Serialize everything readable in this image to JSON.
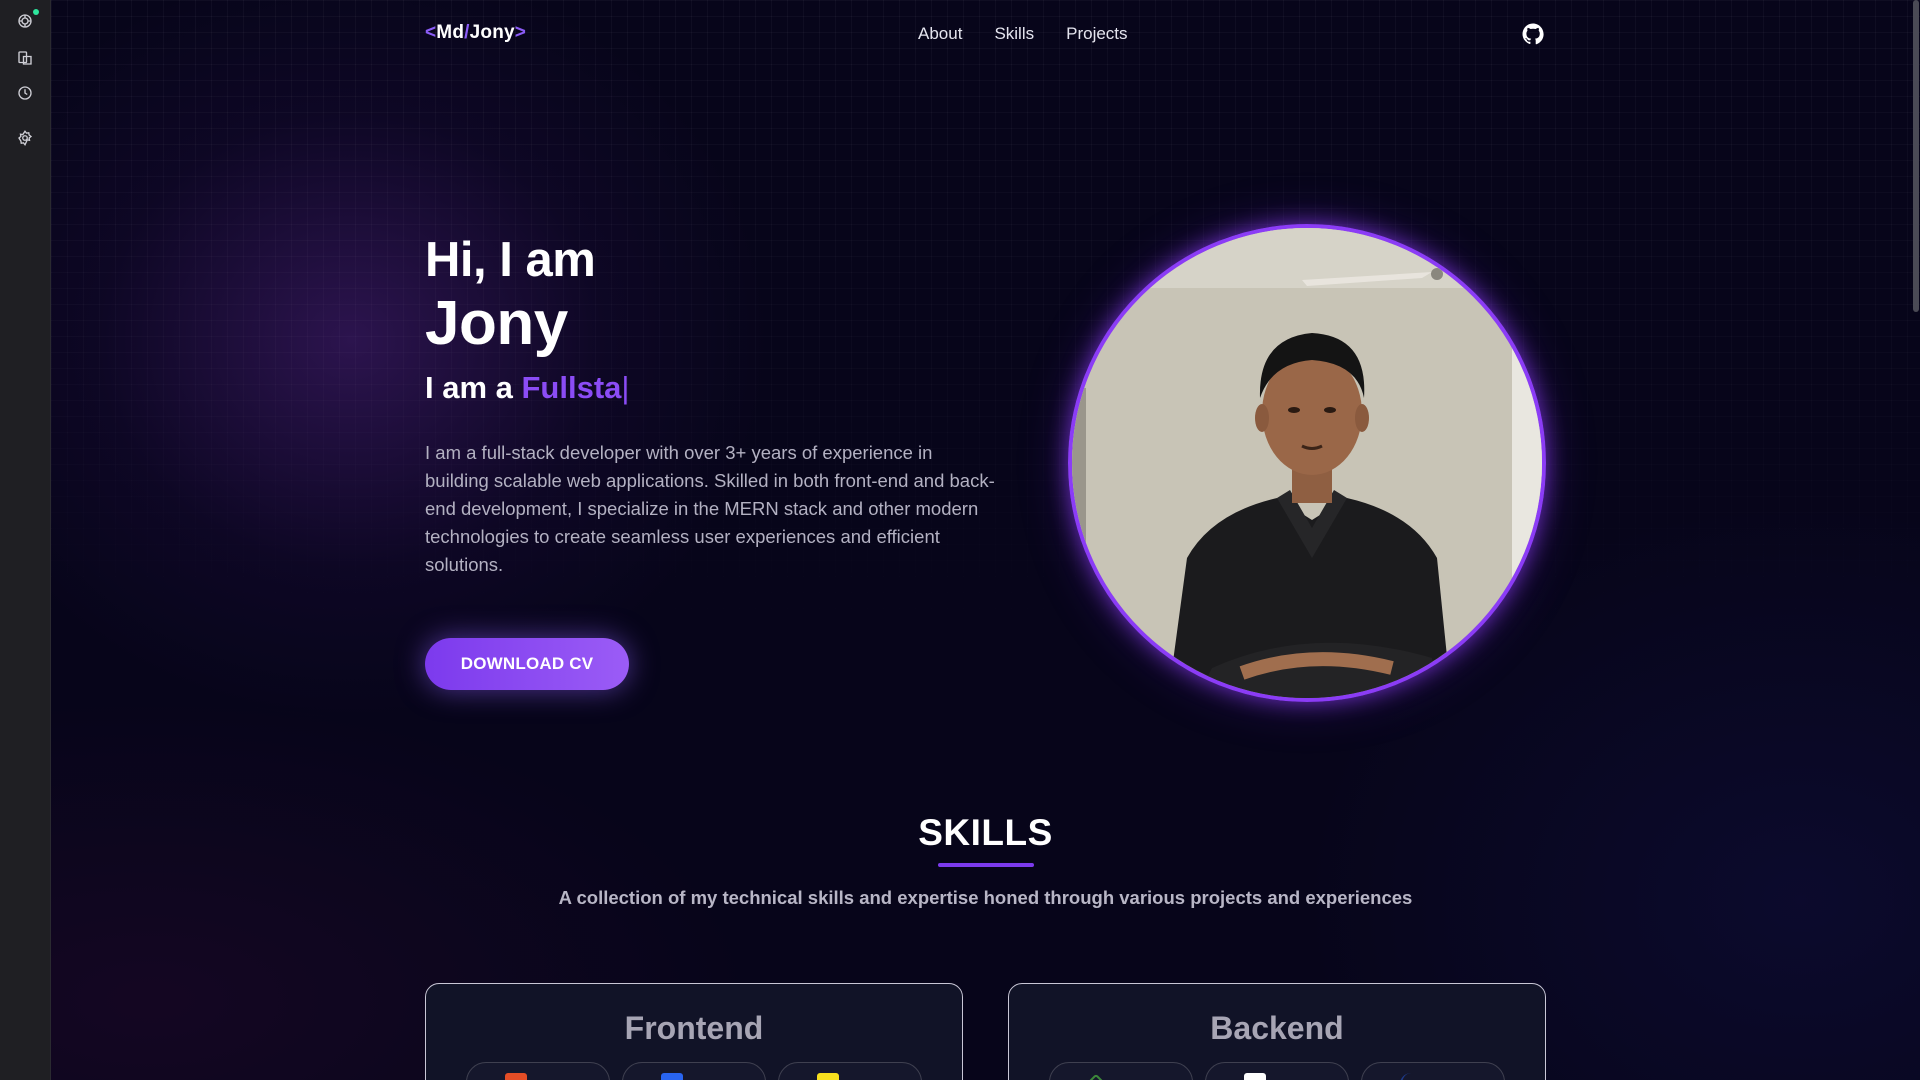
{
  "sidebar": {
    "icons": [
      "assistant-icon",
      "reading-list-icon",
      "history-icon",
      "settings-icon"
    ]
  },
  "header": {
    "logo": {
      "left_bracket": "<",
      "first": "Md",
      "slash": "/",
      "last": "Jony",
      "right_bracket": ">"
    },
    "nav": [
      "About",
      "Skills",
      "Projects"
    ],
    "github_icon": "github-icon"
  },
  "hero": {
    "greeting": "Hi, I am",
    "name": "Jony",
    "role_prefix": "I am a ",
    "role_typed": "Fullsta",
    "caret": "|",
    "description": "I am a full-stack developer with over 3+ years of experience in building scalable web applications. Skilled in both front-end and back-end development, I specialize in the MERN stack and other modern technologies to create seamless user experiences and efficient solutions.",
    "cta": "DOWNLOAD CV"
  },
  "skills": {
    "title": "SKILLS",
    "subtitle": "A collection of my technical skills and expertise honed through various projects and experiences",
    "categories": [
      {
        "title": "Frontend",
        "chip_icons": [
          "html-icon",
          "css-icon",
          "javascript-icon"
        ]
      },
      {
        "title": "Backend",
        "chip_icons": [
          "nodejs-icon",
          "express-icon",
          "mongodb-icon"
        ]
      }
    ]
  },
  "colors": {
    "accent": "#8b5cf6",
    "background": "#07051a",
    "card_bg": "#111327"
  }
}
